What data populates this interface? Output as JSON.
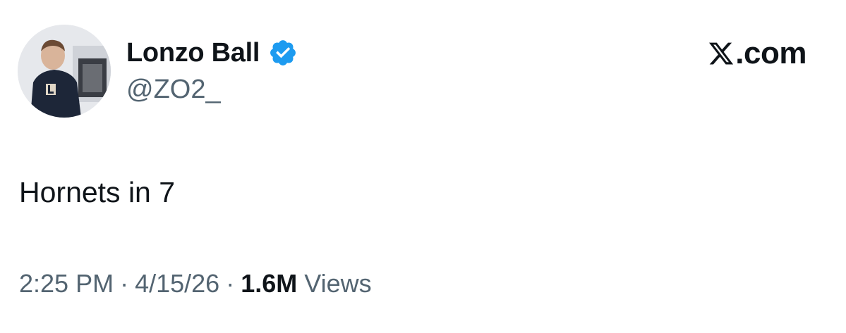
{
  "author": {
    "display_name": "Lonzo Ball",
    "handle": "@ZO2_",
    "verified": true,
    "avatar_icon": "profile-photo-avatar"
  },
  "brand": {
    "logo_icon": "x-logo-icon",
    "suffix": ".com"
  },
  "tweet": {
    "text": "Hornets in 7"
  },
  "meta": {
    "time": "2:25 PM",
    "separator": "·",
    "date": "4/15/26",
    "views_count": "1.6M",
    "views_label": "Views"
  },
  "colors": {
    "text_primary": "#0f1419",
    "text_secondary": "#536471",
    "verified_blue": "#1d9bf0",
    "background": "#ffffff"
  }
}
